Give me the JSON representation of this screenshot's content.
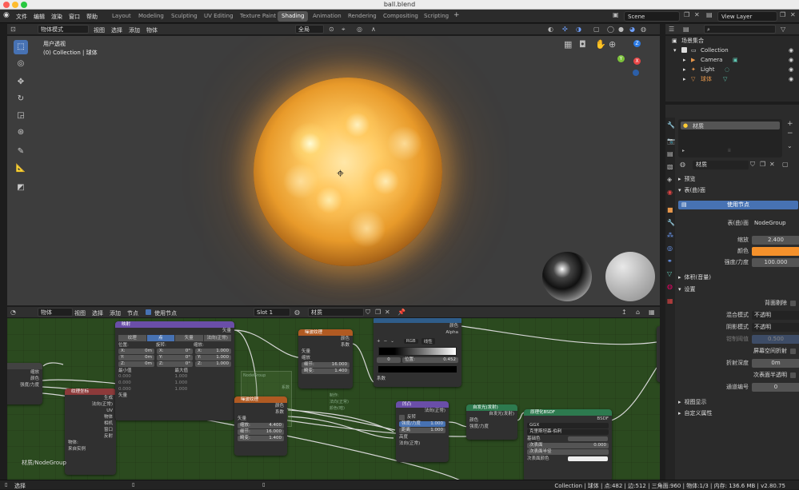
{
  "window": {
    "title": "ball.blend"
  },
  "menu": [
    "文件",
    "编辑",
    "渲染",
    "窗口",
    "帮助"
  ],
  "workspaces": [
    "Layout",
    "Modeling",
    "Sculpting",
    "UV Editing",
    "Texture Paint",
    "Shading",
    "Animation",
    "Rendering",
    "Compositing",
    "Scripting"
  ],
  "active_workspace": "Shading",
  "scene": "Scene",
  "view_layer": "View Layer",
  "viewport": {
    "mode": "物体模式",
    "menus": [
      "视图",
      "选择",
      "添加",
      "物体"
    ],
    "transform": "全局",
    "overlay_title": "用户透视",
    "overlay_sub": "(0) Collection | 球体"
  },
  "node_editor": {
    "mode": "物体",
    "menus": [
      "视图",
      "选择",
      "添加",
      "节点"
    ],
    "use_nodes": "使用节点",
    "slot": "Slot 1",
    "material": "材质",
    "footer": "材质/NodeGroup"
  },
  "nodes": {
    "mapping": {
      "title": "映射",
      "out": "矢量",
      "tabs": [
        "纹理",
        "点",
        "矢量",
        "法向(正常)"
      ],
      "loc": "位置:",
      "rot": "旋转:",
      "scale": "缩放:",
      "lx": "X:",
      "lxv": "0m",
      "ly": "Y:",
      "lyv": "0m",
      "lz": "Z:",
      "lzv": "0m",
      "rx": "X:",
      "rxv": "0°",
      "ry": "Y:",
      "ryv": "0°",
      "rz": "Z:",
      "rzv": "0°",
      "sx": "X:",
      "sxv": "1.000",
      "sy": "Y:",
      "syv": "1.000",
      "sz": "Z:",
      "szv": "1.000",
      "min": "最小值",
      "max": "最大值",
      "minv": "0.000",
      "maxv": "1.000",
      "in": "矢量"
    },
    "texcoord": {
      "title": "纹理坐标",
      "rows": [
        "生成",
        "法向(正常)",
        "UV",
        "物体",
        "相机",
        "窗口",
        "反射"
      ],
      "obj": "物体:",
      "inst": "来自实例"
    },
    "noise1": {
      "title": "噪波纹理",
      "out1": "颜色",
      "out2": "系数",
      "in": "矢量",
      "scale": "缩放",
      "detail": "细节:",
      "detail_v": "16.000",
      "distort": "畸变:",
      "distort_v": "1.400"
    },
    "noise2": {
      "title": "噪波纹理",
      "out1": "颜色",
      "out2": "系数",
      "in": "矢量",
      "scale": "缩放:",
      "scale_v": "4.400",
      "detail": "细节:",
      "detail_v": "16.000",
      "distort": "畸变:",
      "distort_v": "1.400"
    },
    "ramp": {
      "out1": "颜色",
      "out2": "Alpha",
      "mode": "RGB",
      "interp": "线性",
      "idx": "0",
      "pos": "位置:",
      "pos_v": "0.452",
      "in": "系数"
    },
    "bump": {
      "title": "凹凸",
      "out": "法向(正常)",
      "invert": "反转",
      "strength": "强度/力度",
      "strength_v": "1.000",
      "dist": "距离",
      "dist_v": "1.000",
      "height": "高度",
      "normal": "法向(正常)"
    },
    "emission": {
      "title": "自发光(发射)",
      "out": "自发光(发射)",
      "color": "颜色",
      "strength": "强度/力度"
    },
    "bsdf": {
      "title": "原理化BSDF",
      "out": "BSDF",
      "dist": "GGX",
      "sss": "克里斯坦森-伯利",
      "base": "基础色",
      "sub": "次表面",
      "sub_v": "0.000",
      "subr": "次表面半径",
      "subc": "次表面颜色"
    },
    "group": {
      "rows": [
        "缩放",
        "颜色",
        "强度/力度"
      ]
    },
    "frame": {
      "label": "NodeGroup",
      "items": [
        "制作:",
        "法向(正常)",
        "颜色(暗)"
      ],
      "out": "系数"
    }
  },
  "outliner": {
    "root": "场景集合",
    "items": [
      "Collection",
      "Camera",
      "Light",
      "球体"
    ]
  },
  "properties": {
    "object": "球体",
    "material_tab": "材质",
    "slot_name": "材质",
    "material": "材质",
    "preview": "预览",
    "surface": "表(曲)面",
    "use_nodes": "使用节点",
    "surface_label": "表(曲)面",
    "surface_value": "NodeGroup",
    "scale_label": "缩放",
    "scale_value": "2.400",
    "color_label": "颜色",
    "color_value": "#f5912b",
    "strength_label": "强度/力度",
    "strength_value": "100.000",
    "volume": "体积(音量)",
    "settings": "设置",
    "backface": "背面剔除",
    "blend_label": "混合模式",
    "blend_value": "不透明",
    "shadow_label": "阴影模式",
    "shadow_value": "不透明",
    "clip_label": "钳制阈值",
    "clip_value": "0.500",
    "ssr": "屏幕空间折射",
    "refr_label": "折射深度",
    "refr_value": "0m",
    "sss_trans": "次表面半透明",
    "pass_label": "通道编号",
    "pass_value": "0",
    "viewport_display": "视图显示",
    "custom": "自定义属性"
  },
  "status": {
    "left": "选择",
    "right": "Collection | 球体 | 点:482 | 边:512 | 三角面:960 | 物体:1/3 | 内存: 136.6 MB | v2.80.75"
  }
}
